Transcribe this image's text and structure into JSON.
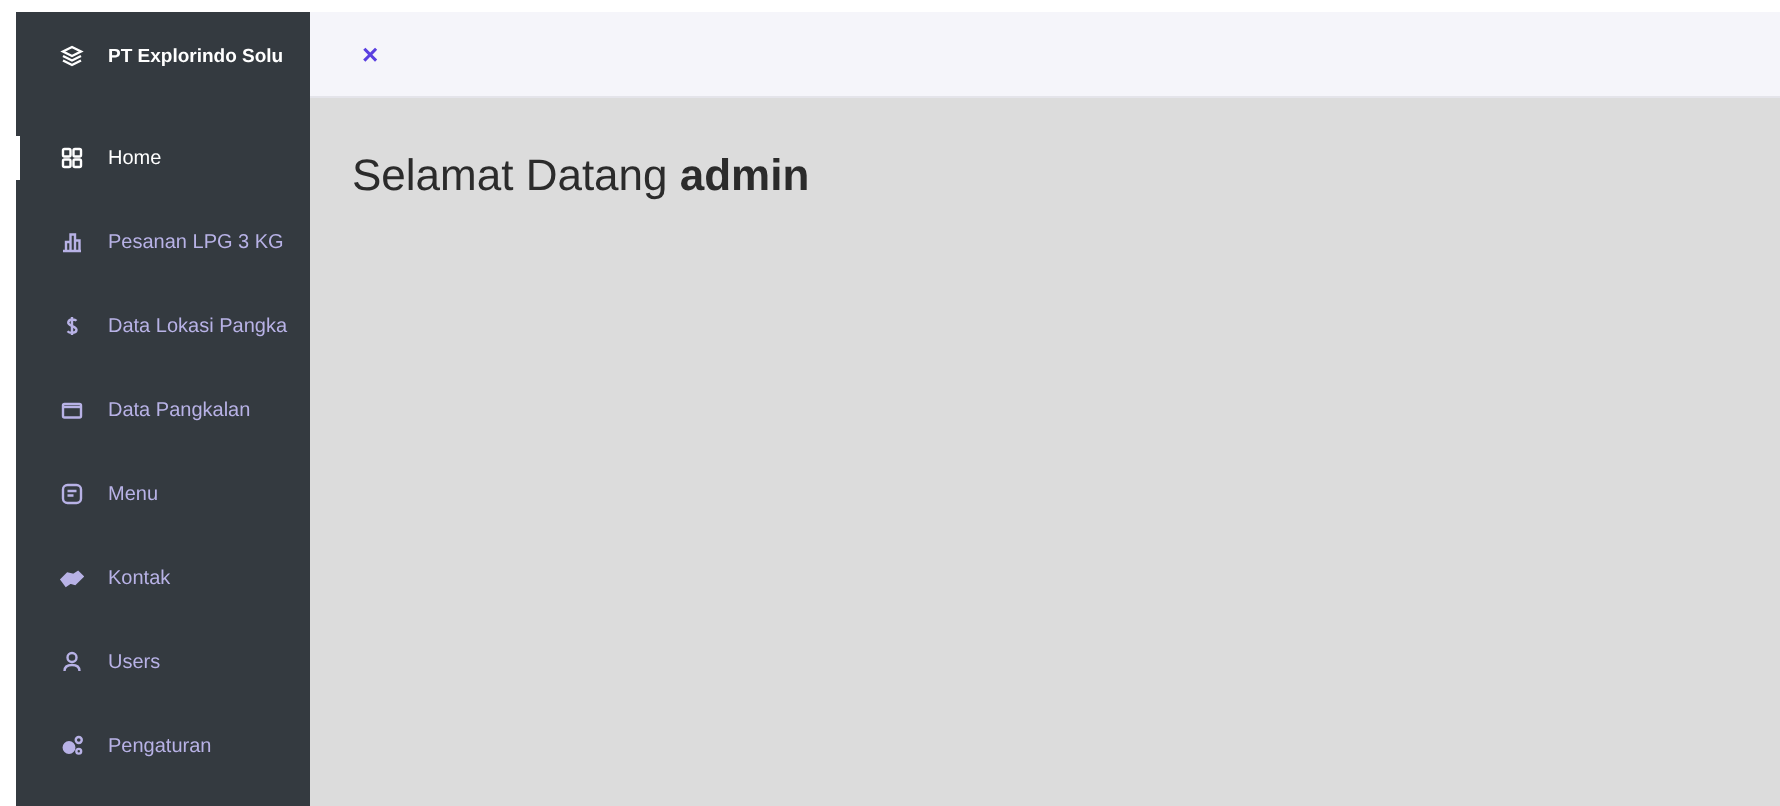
{
  "sidebar": {
    "brand": "PT Explorindo Solu",
    "items": [
      {
        "label": "Home",
        "selected": true
      },
      {
        "label": "Pesanan LPG 3 KG",
        "selected": false
      },
      {
        "label": "Data Lokasi Pangka",
        "selected": false
      },
      {
        "label": "Data Pangkalan",
        "selected": false
      },
      {
        "label": "Menu",
        "selected": false
      },
      {
        "label": "Kontak",
        "selected": false
      },
      {
        "label": "Users",
        "selected": false
      },
      {
        "label": "Pengaturan",
        "selected": false
      }
    ]
  },
  "header": {
    "close": "×"
  },
  "main": {
    "greeting": "Selamat Datang **admin**"
  }
}
